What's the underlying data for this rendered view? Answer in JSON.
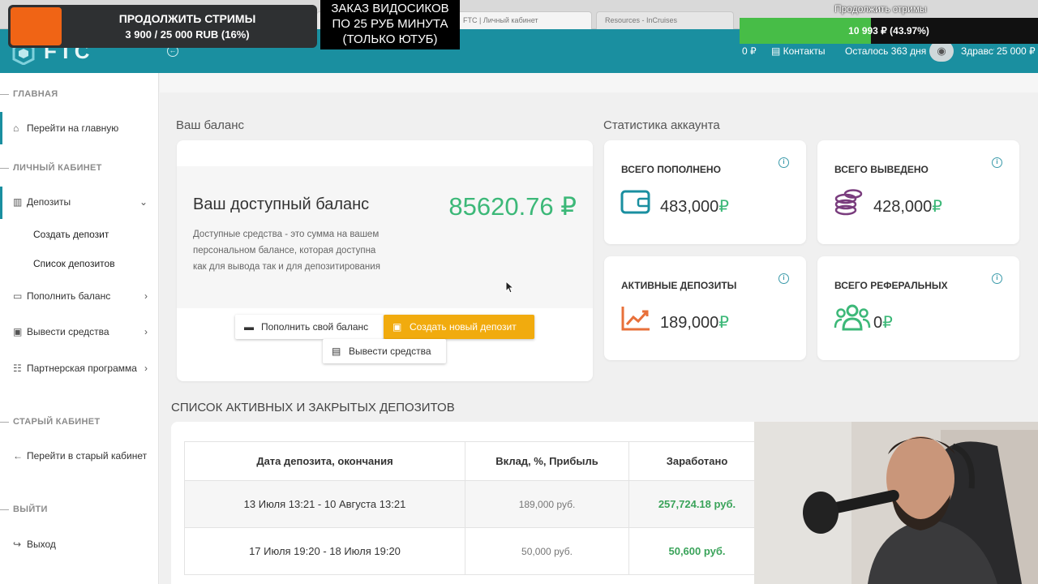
{
  "browser": {
    "tabs": [
      "",
      "",
      "FTC | Личный кабинет",
      "Resources - InCruises"
    ]
  },
  "header": {
    "logo": "FTC",
    "balance": "0 ₽",
    "contacts": "Контакты",
    "remaining": "Осталось 363 дня",
    "greeting": "Здравствуйте"
  },
  "sidebar": {
    "sections": {
      "main": "ГЛАВНАЯ",
      "cabinet": "ЛИЧНЫЙ КАБИНЕТ",
      "old": "СТАРЫЙ КАБИНЕТ",
      "exit": "ВЫЙТИ"
    },
    "items": {
      "home": "Перейти на главную",
      "deposits": "Депозиты",
      "create_deposit": "Создать депозит",
      "deposit_list": "Список депозитов",
      "top_up": "Пополнить баланс",
      "withdraw": "Вывести средства",
      "partner": "Партнерская программа",
      "old_cabinet": "Перейти в старый кабинет",
      "logout": "Выход"
    }
  },
  "main": {
    "balance_title": "Ваш баланс",
    "stats_title": "Статистика аккаунта",
    "balance": {
      "heading": "Ваш доступный баланс",
      "amount": "85620.76 ₽",
      "description": "Доступные средства - это сумма на вашем персональном балансе, которая доступна как для вывода так и для депозитирования"
    },
    "buttons": {
      "top_up": "Пополнить свой баланс",
      "new_deposit": "Создать новый депозит",
      "withdraw": "Вывести средства"
    },
    "stats": {
      "total_deposited": {
        "label": "ВСЕГО ПОПОЛНЕНО",
        "value": "483,000",
        "currency": "₽",
        "icon": "wallet-icon"
      },
      "total_withdrawn": {
        "label": "ВСЕГО ВЫВЕДЕНО",
        "value": "428,000",
        "currency": "₽",
        "icon": "coins-icon"
      },
      "active_deposits": {
        "label": "АКТИВНЫЕ ДЕПОЗИТЫ",
        "value": "189,000",
        "currency": "₽",
        "icon": "chart-up-icon"
      },
      "total_referrals": {
        "label": "ВСЕГО РЕФЕРАЛЬНЫХ",
        "value": "0",
        "currency": "₽",
        "icon": "users-icon"
      }
    },
    "deposits_title": "СПИСОК АКТИВНЫХ И ЗАКРЫТЫХ ДЕПОЗИТОВ",
    "table": {
      "headers": [
        "Дата депозита, окончания",
        "Вклад, %, Прибыль",
        "Заработано"
      ],
      "rows": [
        [
          "13 Июля 13:21 - 10 Августа 13:21",
          "189,000 руб.",
          "257,724.18 руб."
        ],
        [
          "17 Июля 19:20 - 18 Июля 19:20",
          "50,000 руб.",
          "50,600 руб."
        ]
      ]
    }
  },
  "overlays": {
    "donation_title": "ПРОДОЛЖИТЬ СТРИМЫ",
    "donation_progress": "3 900 / 25 000 RUB (16%)",
    "order_line1": "ЗАКАЗ ВИДОСИКОВ",
    "order_line2": "ПО 25 РУБ МИНУТА",
    "order_line3": "(ТОЛЬКО ЮТУБ)",
    "goal_title": "Продолжить стримы",
    "goal_text": "10 993 ₽ (43.97%)",
    "goal_fraction": 0.4397,
    "goal_target": "25 000 ₽"
  },
  "colors": {
    "header_teal": "#1a8fa0",
    "balance_green": "#3cb878",
    "button_yellow": "#f1ab0e",
    "overlay_orange": "#f06415",
    "goal_green": "#47bd47"
  }
}
